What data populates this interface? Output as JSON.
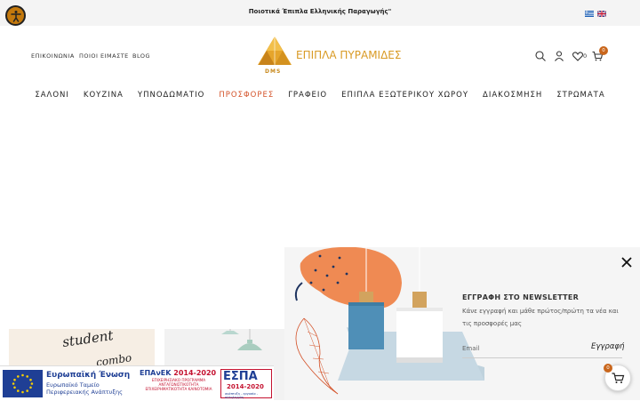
{
  "topbar": {
    "announcement": "Ποιοτικά Έπιπλα Ελληνικής Παραγωγής\"",
    "accessibility_icon": "accessibility-icon",
    "languages": [
      "Greek",
      "English"
    ]
  },
  "header": {
    "links": [
      "ΕΠΙΚΟΙΝΩΝΙΑ",
      "ΠΟΙΟΙ ΕΙΜΑΣΤΕ",
      "BLOG"
    ],
    "logo_text": "ΕΠΙΠΛΑ ΠΥΡΑΜΙΔΕΣ",
    "logo_sub": "DMS",
    "wishlist_count": "0",
    "cart_count": "0",
    "icons": [
      "search-icon",
      "user-icon",
      "heart-icon",
      "cart-icon"
    ]
  },
  "nav": {
    "items": [
      "ΣΑΛΟΝΙ",
      "ΚΟΥΖΙΝΑ",
      "ΥΠΝΟΔΩΜΑΤΙΟ",
      "ΠΡΟΣΦΟΡΕΣ",
      "ΓΡΑΦΕΙΟ",
      "ΕΠΙΠΛΑ ΕΞΩΤΕΡΙΚΟΥ ΧΩΡΟΥ",
      "ΔΙΑΚΟΣΜΗΣΗ",
      "ΣΤΡΩΜΑΤΑ"
    ],
    "active": "ΠΡΟΣΦΟΡΕΣ",
    "active_color": "#d4532a"
  },
  "cards": {
    "card1_line1": "student",
    "card1_line2": "combo"
  },
  "newsletter": {
    "title": "ΕΓΓΡΑΦΗ ΣΤΟ NEWSLETTER",
    "description": "Κάνε εγγραφή και μάθε πρώτος/πρώτη τα νέα και τις προσφορές μας",
    "email_placeholder": "Email",
    "subscribe_label": "Εγγραφή"
  },
  "espa_banner": {
    "eu_title": "Ευρωπαϊκή Ένωση",
    "eu_subtitle": "Ευρωπαϊκό Ταμείο Περιφερειακής Ανάπτυξης",
    "epanek_title": "ΕΠΑνΕΚ",
    "epanek_years": "2014-2020",
    "epanek_desc": "ΕΠΙΧΕΙΡΗΣΙΑΚΟ ΠΡΟΓΡΑΜΜΑ ΑΝΤΑΓΩΝΙΣΤΙΚΟΤΗΤΑ ΕΠΙΧΕΙΡΗΜΑΤΙΚΟΤΗΤΑ ΚΑΙΝΟΤΟΜΙΑ",
    "espa_title": "ΕΣΠΑ",
    "espa_years": "2014-2020",
    "espa_slogan": "ανάπτυξη - εργασία - αλληλεγγύη"
  },
  "floating_cart": {
    "count": "0"
  },
  "colors": {
    "accent": "#c9661c",
    "logo": "#d99a24",
    "eu_blue": "#1f3f95",
    "espa_red": "#c41230"
  }
}
